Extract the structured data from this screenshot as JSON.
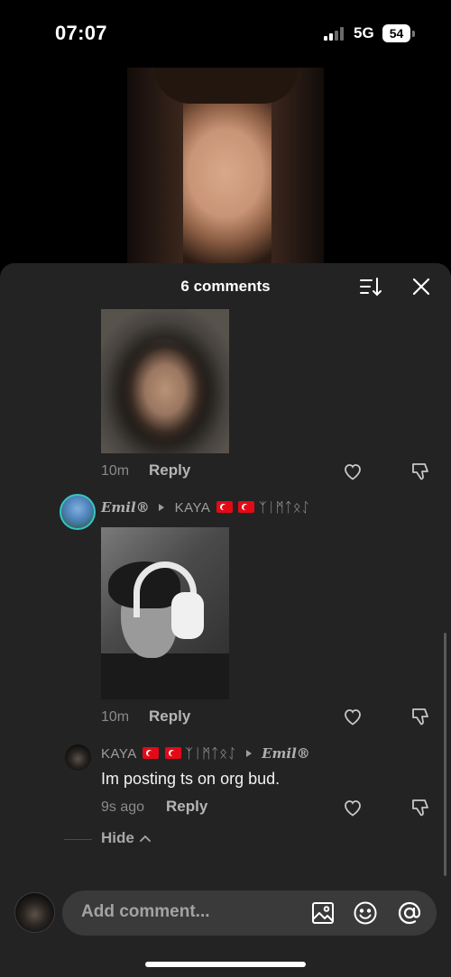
{
  "status_bar": {
    "time": "07:07",
    "network": "5G",
    "battery": "54"
  },
  "sheet": {
    "title": "6 comments"
  },
  "comments": [
    {
      "time": "10m",
      "reply_label": "Reply"
    },
    {
      "author": "Emil®",
      "reply_to": "KAYA",
      "reply_to_suffix": "ᛉᛁᛗᛏᛟᛇ",
      "time": "10m",
      "reply_label": "Reply"
    },
    {
      "author": "KAYA",
      "author_suffix": "ᛉᛁᛗᛏᛟᛇ",
      "reply_to": "Emil®",
      "text": "Im posting ts on org bud.",
      "time": "9s ago",
      "reply_label": "Reply"
    }
  ],
  "hide_label": "Hide",
  "input": {
    "placeholder": "Add comment..."
  },
  "colors": {
    "sheet_bg": "#232323",
    "input_bg": "#3a3a3a",
    "flag_red": "#e30a17"
  }
}
